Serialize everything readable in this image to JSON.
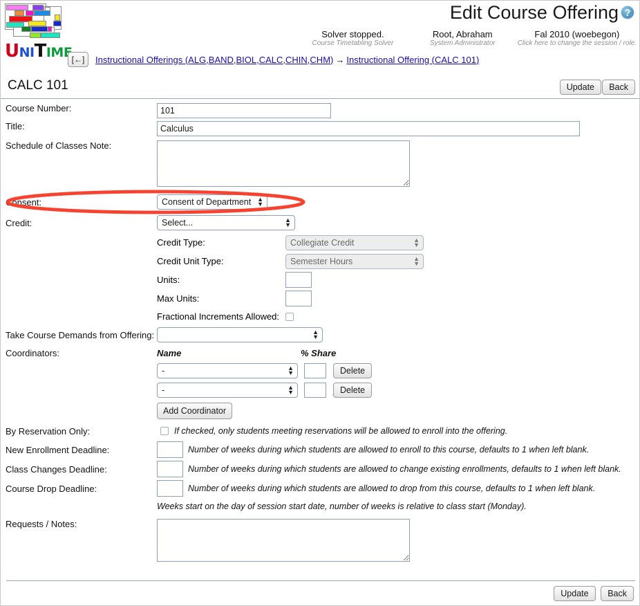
{
  "header": {
    "title": "Edit Course Offering",
    "help_icon": "help-icon",
    "logo_wordmark": {
      "u": "U",
      "ni": "NI",
      "t": "T",
      "ime": "IME"
    },
    "status": [
      {
        "main": "Solver stopped.",
        "sub": "Course Timetabling Solver"
      },
      {
        "main": "Root, Abraham",
        "sub": "System Administrator"
      },
      {
        "main": "Fal 2010 (woebegon)",
        "sub": "Click here to change the session / role."
      }
    ],
    "back_button": "[←]",
    "breadcrumb": {
      "first": "Instructional Offerings (ALG,BAND,BIOL,CALC,CHIN,CHM)",
      "separator": "→",
      "second": "Instructional Offering (CALC 101)"
    }
  },
  "toolbar": {
    "course_code": "CALC 101",
    "update_label": "Update",
    "back_label": "Back"
  },
  "form": {
    "course_number": {
      "label": "Course Number:",
      "value": "101"
    },
    "title": {
      "label": "Title:",
      "value": "Calculus"
    },
    "schedule_note": {
      "label": "Schedule of Classes Note:",
      "value": ""
    },
    "consent": {
      "label": "Consent:",
      "value": "Consent of Department"
    },
    "credit": {
      "label": "Credit:",
      "value": "Select..."
    },
    "credit_type": {
      "label": "Credit Type:",
      "value": "Collegiate Credit"
    },
    "credit_unit_type": {
      "label": "Credit Unit Type:",
      "value": "Semester Hours"
    },
    "units": {
      "label": "Units:",
      "value": ""
    },
    "max_units": {
      "label": "Max Units:",
      "value": ""
    },
    "fractional": {
      "label": "Fractional Increments Allowed:"
    },
    "take_demands": {
      "label": "Take Course Demands from Offering:",
      "value": ""
    },
    "coordinators": {
      "label": "Coordinators:",
      "col_name": "Name",
      "col_share": "% Share",
      "rows": [
        {
          "name": "-",
          "share": "",
          "delete_label": "Delete"
        },
        {
          "name": "-",
          "share": "",
          "delete_label": "Delete"
        }
      ],
      "add_label": "Add Coordinator"
    },
    "by_reservation": {
      "label": "By Reservation Only:",
      "hint": "If checked, only students meeting reservations will be allowed to enroll into the offering."
    },
    "new_enrollment_deadline": {
      "label": "New Enrollment Deadline:",
      "value": "",
      "hint": "Number of weeks during which students are allowed to enroll to this course, defaults to 1 when left blank."
    },
    "class_changes_deadline": {
      "label": "Class Changes Deadline:",
      "value": "",
      "hint": "Number of weeks during which students are allowed to change existing enrollments, defaults to 1 when left blank."
    },
    "course_drop_deadline": {
      "label": "Course Drop Deadline:",
      "value": "",
      "hint": "Number of weeks during which students are allowed to drop from this course, defaults to 1 when left blank."
    },
    "weeks_note": "Weeks start on the day of session start date, number of weeks is relative to class start (Monday).",
    "requests_notes": {
      "label": "Requests / Notes:",
      "value": ""
    }
  },
  "footer": {
    "update_label": "Update",
    "back_label": "Back"
  },
  "colors": {
    "link": "#1a0dab",
    "annotation": "#f5402c",
    "rule": "#9aa8b8"
  }
}
